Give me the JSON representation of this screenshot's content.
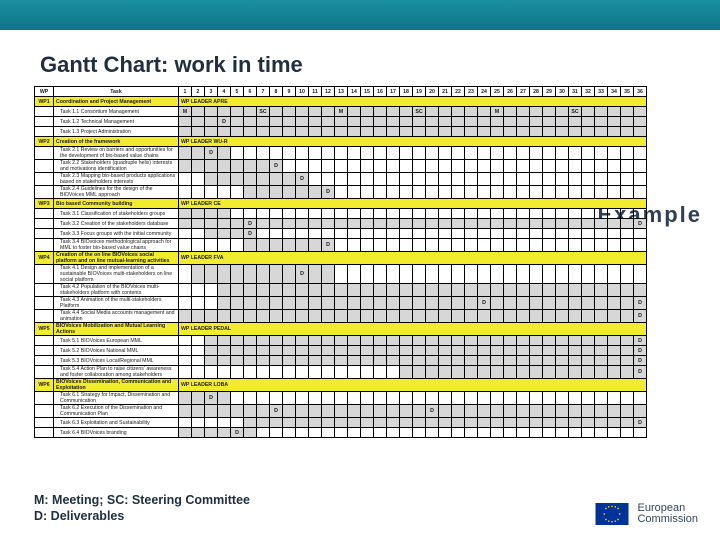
{
  "chart_data": {
    "type": "table",
    "title": "Gantt Chart: work in time",
    "columns": {
      "wp": "WP",
      "task": "Task",
      "months": 36
    },
    "legend": {
      "M": "Meeting",
      "SC": "Steering Committee",
      "D": "Deliverables"
    },
    "rows": [
      {
        "wp": "WP1",
        "task": "Coordination and Project Management",
        "leader": "WP LEADER APRE",
        "type": "wp"
      },
      {
        "task": "Task 1.1 Consortium Management",
        "events": {
          "1": "M",
          "7": "SC",
          "13": "M",
          "19": "SC",
          "25": "M",
          "31": "SC"
        },
        "shade": [
          1,
          36
        ]
      },
      {
        "task": "Task 1.2 Technical Management",
        "events": {
          "4": "D"
        },
        "shade": [
          1,
          36
        ]
      },
      {
        "task": "Task 1.3 Project Administration",
        "shade": [
          1,
          36
        ]
      },
      {
        "wp": "WP2",
        "task": "Creation of the framework",
        "leader": "WP LEADER WU-R",
        "type": "wp"
      },
      {
        "task": "Task 2.1 Review on barriers and opportunities for the development of bio-based value chains",
        "events": {
          "3": "D"
        },
        "shade": [
          1,
          4
        ]
      },
      {
        "task": "Task 2.2 Stakeholders (quadruple helix) interests and motivations identification",
        "events": {
          "8": "D"
        },
        "shade": [
          1,
          8
        ]
      },
      {
        "task": "Task 2.3 Mapping bio-based products applications based on stakeholders interests",
        "events": {
          "10": "D"
        },
        "shade": [
          3,
          10
        ]
      },
      {
        "task": "Task 2.4 Guidelines for the design of the BIOVoices MML approach",
        "events": {
          "12": "D"
        },
        "shade": [
          6,
          12
        ]
      },
      {
        "wp": "WP3",
        "task": "Bio based Community building",
        "leader": "WP LEADER CE",
        "type": "wp"
      },
      {
        "task": "Task 3.1 Classification of stakeholders groups",
        "shade": [
          1,
          4
        ]
      },
      {
        "task": "Task 3.2 Creation of the stakeholders database",
        "events": {
          "6": "D",
          "36": "D"
        },
        "shade": [
          1,
          36
        ]
      },
      {
        "task": "Task 3.3 Focus groups with the initial community",
        "events": {
          "6": "D"
        },
        "shade": [
          3,
          6
        ]
      },
      {
        "task": "Task 3.4 BIOvoices methodological approach for MML to foster bio-based value chains",
        "events": {
          "12": "D"
        },
        "shade": [
          6,
          12
        ]
      },
      {
        "wp": "WP4",
        "task": "Creation of the on line BIOVoices social platform and on line mutual-learning activities",
        "leader": "WP LEADER FVA",
        "type": "wp"
      },
      {
        "task": "Task 4.1 Design and implementation of a sustainable BIOVoices multi-stakeholders on line social platform",
        "events": {
          "10": "D"
        },
        "shade": [
          2,
          12
        ]
      },
      {
        "task": "Task 4.2 Population of the BIOVoices multi-stakeholders platform with contents",
        "shade": [
          4,
          36
        ]
      },
      {
        "task": "Task 4.3 Animation of the multi-stakeholders Platform",
        "events": {
          "24": "D",
          "36": "D"
        },
        "shade": [
          4,
          36
        ]
      },
      {
        "task": "Task 4.4 Social Media accounts management and animation",
        "events": {
          "36": "D"
        },
        "shade": [
          1,
          36
        ]
      },
      {
        "wp": "WP5",
        "task": "BIOVoices Mobilization and Mutual Learning Actions",
        "leader": "WP LEADER PEDAL",
        "type": "wp"
      },
      {
        "task": "Task 5.1 BIOVoices European MML",
        "events": {
          "36": "D"
        },
        "shade": [
          3,
          36
        ]
      },
      {
        "task": "Task 5.2 BIOVoices National MML",
        "events": {
          "36": "D"
        },
        "shade": [
          3,
          36
        ]
      },
      {
        "task": "Task 5.3 BIOVoices Local/Regional MML",
        "events": {
          "36": "D"
        },
        "shade": [
          3,
          36
        ]
      },
      {
        "task": "Task 5.4 Action Plan to raise citizens' awareness and foster collaboration among stakeholders",
        "events": {
          "36": "D"
        },
        "shade": [
          18,
          36
        ]
      },
      {
        "wp": "WP6",
        "task": "BIOVoices Dissemination, Communication and Exploitation",
        "leader": "WP LEADER LOBA",
        "type": "wp"
      },
      {
        "task": "Task 6.1 Strategy for Impact, Dissemination and Communication",
        "events": {
          "3": "D"
        },
        "shade": [
          1,
          4
        ]
      },
      {
        "task": "Task 6.2 Execution of the Dissemination and Communication Plan",
        "events": {
          "8": "D",
          "20": "D"
        },
        "shade": [
          1,
          36
        ]
      },
      {
        "task": "Task 6.3 Exploitation and Sustainability",
        "events": {
          "36": "D"
        },
        "shade": [
          6,
          36
        ]
      },
      {
        "task": "Task 6.4 BIOVoices branding",
        "events": {
          "5": "D"
        },
        "shade": [
          1,
          6
        ]
      }
    ]
  },
  "title": "Gantt Chart: work in time",
  "example_label": "Example",
  "legend_line1": "M: Meeting; SC: Steering Committee",
  "legend_line2": "D: Deliverables",
  "logo_line1": "European",
  "logo_line2": "Commission"
}
